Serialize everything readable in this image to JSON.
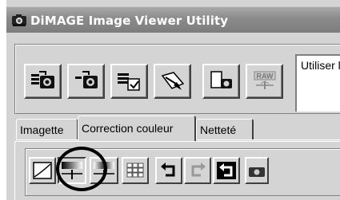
{
  "window": {
    "title": "DiMAGE Image Viewer Utility",
    "icon": "dimage-app-icon"
  },
  "top_toolbar": {
    "buttons": [
      {
        "name": "import-camera-button",
        "icon": "camera-import-icon"
      },
      {
        "name": "camera-single-button",
        "icon": "camera-single-icon"
      },
      {
        "name": "batch-save-button",
        "icon": "batch-save-icon"
      },
      {
        "name": "print-button",
        "icon": "print-icon"
      },
      {
        "name": "document-camera-button",
        "icon": "document-camera-icon"
      },
      {
        "name": "raw-button",
        "icon": "raw-icon",
        "label": "RAW"
      }
    ],
    "language_text": "Utiliser la"
  },
  "tabs": [
    {
      "label": "Imagette",
      "active": false
    },
    {
      "label": "Correction couleur",
      "active": true
    },
    {
      "label": "Netteté",
      "active": false
    }
  ],
  "color_toolbar": {
    "buttons": [
      {
        "name": "tone-curve-button",
        "icon": "tone-curve-icon"
      },
      {
        "name": "color-balance-button",
        "icon": "color-balance-icon",
        "pressed": true
      },
      {
        "name": "brightness-contrast-button",
        "icon": "brightness-contrast-icon"
      },
      {
        "name": "color-grid-button",
        "icon": "grid-icon"
      },
      {
        "name": "undo-button",
        "icon": "undo-icon"
      },
      {
        "name": "redo-button",
        "icon": "redo-icon"
      },
      {
        "name": "reset-button",
        "icon": "reset-icon"
      },
      {
        "name": "camera-snapshot-button",
        "icon": "camera-icon"
      }
    ]
  },
  "colors": {
    "title_bar": "#8a8a8a",
    "face": "#d4d4d4",
    "highlight_ring": "#000000"
  }
}
